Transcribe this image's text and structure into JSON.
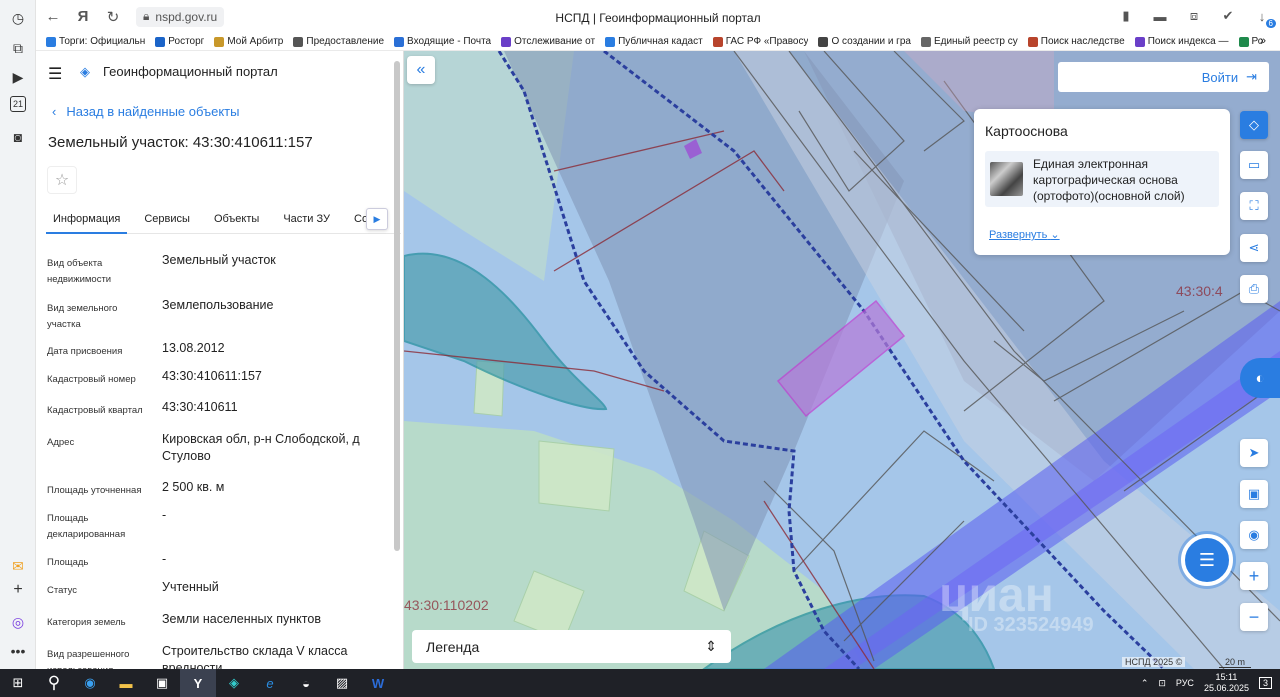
{
  "browser": {
    "address": "nspd.gov.ru",
    "title": "НСПД | Геоинформационный портал",
    "badge": "6",
    "bookmarks": [
      {
        "label": "Торги: Официальн",
        "color": "#2a7de1"
      },
      {
        "label": "Росторг",
        "color": "#1b64c8"
      },
      {
        "label": "Мой Арбитр",
        "color": "#c8982a"
      },
      {
        "label": "Предоставление",
        "color": "#555555"
      },
      {
        "label": "Входящие - Почта",
        "color": "#2a6fd6"
      },
      {
        "label": "Отслеживание от",
        "color": "#6a3fc8"
      },
      {
        "label": "Публичная кадаст",
        "color": "#2a7de1"
      },
      {
        "label": "ГАС РФ «Правосу",
        "color": "#b8442c"
      },
      {
        "label": "О создании и гра",
        "color": "#444444"
      },
      {
        "label": "Единый реестр су",
        "color": "#666666"
      },
      {
        "label": "Поиск наследстве",
        "color": "#b8442c"
      },
      {
        "label": "Поиск индекса —",
        "color": "#6a3fc8"
      },
      {
        "label": "Ро",
        "color": "#1f8a4c"
      }
    ]
  },
  "rail": {
    "calendar_day": "21"
  },
  "sidebar": {
    "portal_name": "Геоинформационный портал",
    "back_link": "Назад в найденные объекты",
    "object_title": "Земельный участок: 43:30:410611:157",
    "tabs": [
      "Информация",
      "Сервисы",
      "Объекты",
      "Части ЗУ",
      "Соста"
    ],
    "properties": [
      {
        "label": "Вид объекта недвижимости",
        "value": "Земельный участок"
      },
      {
        "label": "Вид земельного участка",
        "value": "Землепользование"
      },
      {
        "label": "Дата присвоения",
        "value": "13.08.2012"
      },
      {
        "label": "Кадастровый номер",
        "value": "43:30:410611:157"
      },
      {
        "label": "Кадастровый квартал",
        "value": "43:30:410611"
      },
      {
        "label": "Адрес",
        "value": "Кировская обл, р-н Слободской, д Стулово"
      },
      {
        "label": "Площадь уточненная",
        "value": "2 500 кв. м"
      },
      {
        "label": "Площадь декларированная",
        "value": "-"
      },
      {
        "label": "Площадь",
        "value": "-"
      },
      {
        "label": "Статус",
        "value": "Учтенный"
      },
      {
        "label": "Категория земель",
        "value": "Земли населенных пунктов"
      },
      {
        "label": "Вид разрешенного использования",
        "value": "Строительство склада V класса вредности"
      }
    ]
  },
  "map": {
    "login_label": "Войти",
    "basemap_title": "Картооснова",
    "basemap_item": "Единая электронная картографическая основа (ортофото)(основной слой)",
    "basemap_expand": "Развернуть",
    "legend_label": "Легенда",
    "label_left": "43:30:110202",
    "label_right": "43:30:4",
    "watermark_brand": "циан",
    "watermark_id": "ID 323524949",
    "copyright": "НСПД 2025 ©",
    "scale": "20 m"
  },
  "taskbar": {
    "lang": "РУС",
    "time": "15:11",
    "date": "25.06.2025",
    "notifications": "3"
  },
  "colors": {
    "accent": "#2a7de1",
    "boundary": "#8b2a36",
    "highlight": "#c23bd1"
  }
}
